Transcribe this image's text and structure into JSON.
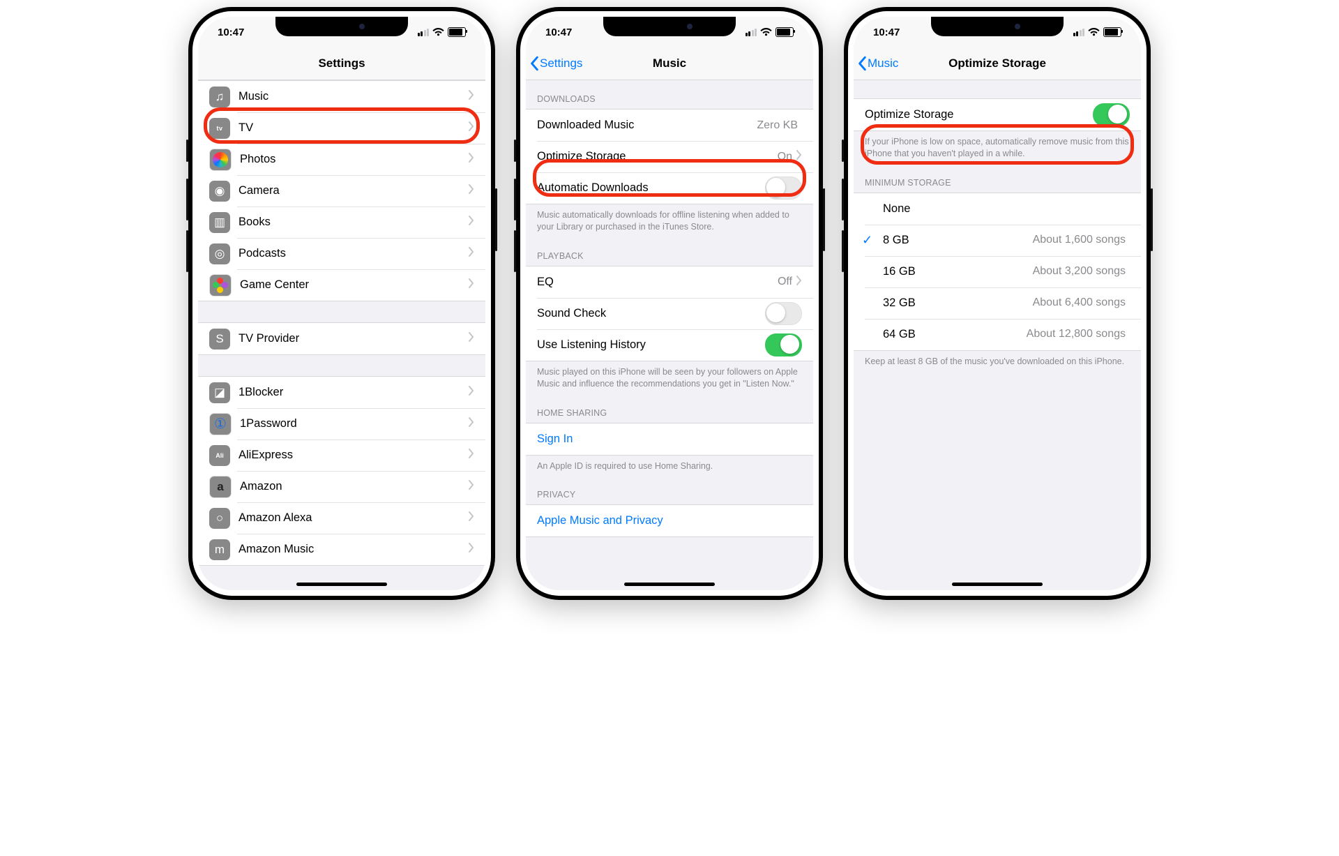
{
  "status": {
    "time": "10:47"
  },
  "phone1": {
    "title": "Settings",
    "apple_items": [
      {
        "name": "Music",
        "icon": "ic-music",
        "glyph": "♫"
      },
      {
        "name": "TV",
        "icon": "ic-tv",
        "glyph": "tv"
      },
      {
        "name": "Photos",
        "icon": "ic-photos",
        "glyph": "flower"
      },
      {
        "name": "Camera",
        "icon": "ic-camera",
        "glyph": "◉"
      },
      {
        "name": "Books",
        "icon": "ic-books",
        "glyph": "▥"
      },
      {
        "name": "Podcasts",
        "icon": "ic-podcasts",
        "glyph": "◎"
      },
      {
        "name": "Game Center",
        "icon": "ic-gamecenter",
        "glyph": "gc"
      }
    ],
    "tvprov": {
      "name": "TV Provider",
      "icon": "ic-tvprov",
      "glyph": "S"
    },
    "third_party": [
      {
        "name": "1Blocker",
        "icon": "ic-1block",
        "glyph": "◪"
      },
      {
        "name": "1Password",
        "icon": "ic-1pass",
        "glyph": "①"
      },
      {
        "name": "AliExpress",
        "icon": "ic-aliex",
        "glyph": "Ali"
      },
      {
        "name": "Amazon",
        "icon": "ic-amazon",
        "glyph": "a"
      },
      {
        "name": "Amazon Alexa",
        "icon": "ic-alexa",
        "glyph": "○"
      },
      {
        "name": "Amazon Music",
        "icon": "ic-amusic",
        "glyph": "m"
      }
    ]
  },
  "phone2": {
    "back": "Settings",
    "title": "Music",
    "sections": {
      "downloads": {
        "header": "DOWNLOADS",
        "rows": [
          {
            "label": "Downloaded Music",
            "detail": "Zero KB"
          },
          {
            "label": "Optimize Storage",
            "detail": "On",
            "chevron": true
          },
          {
            "label": "Automatic Downloads",
            "toggle": false
          }
        ],
        "footer": "Music automatically downloads for offline listening when added to your Library or purchased in the iTunes Store."
      },
      "playback": {
        "header": "PLAYBACK",
        "rows": [
          {
            "label": "EQ",
            "detail": "Off",
            "chevron": true
          },
          {
            "label": "Sound Check",
            "toggle": false
          },
          {
            "label": "Use Listening History",
            "toggle": true
          }
        ],
        "footer": "Music played on this iPhone will be seen by your followers on Apple Music and influence the recommendations you get in \"Listen Now.\""
      },
      "homesharing": {
        "header": "HOME SHARING",
        "row": {
          "label": "Sign In"
        },
        "footer": "An Apple ID is required to use Home Sharing."
      },
      "privacy": {
        "header": "PRIVACY",
        "row": {
          "label": "Apple Music and Privacy"
        }
      }
    }
  },
  "phone3": {
    "back": "Music",
    "title": "Optimize Storage",
    "main": {
      "label": "Optimize Storage",
      "toggle": true
    },
    "main_footer": "If your iPhone is low on space, automatically remove music from this iPhone that you haven't played in a while.",
    "min_header": "MINIMUM STORAGE",
    "options": [
      {
        "label": "None",
        "detail": "",
        "checked": false
      },
      {
        "label": "8 GB",
        "detail": "About 1,600 songs",
        "checked": true
      },
      {
        "label": "16 GB",
        "detail": "About 3,200 songs",
        "checked": false
      },
      {
        "label": "32 GB",
        "detail": "About 6,400 songs",
        "checked": false
      },
      {
        "label": "64 GB",
        "detail": "About 12,800 songs",
        "checked": false
      }
    ],
    "min_footer": "Keep at least 8 GB of the music you've downloaded on this iPhone."
  }
}
